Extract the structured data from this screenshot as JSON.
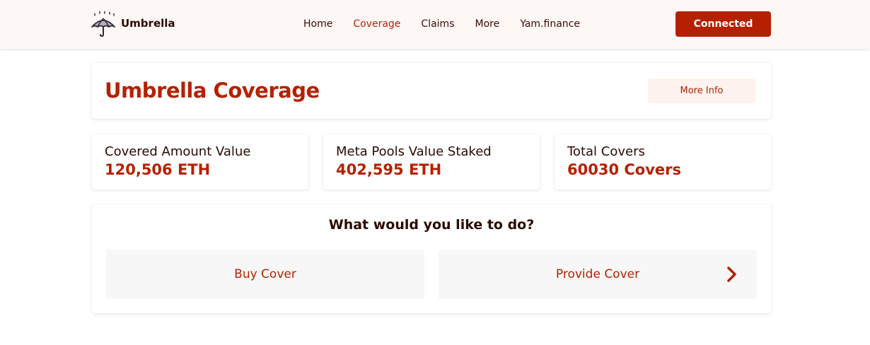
{
  "header": {
    "logo_text": "Umbrella",
    "logo_icon": "umbrella-rain-icon",
    "nav": [
      {
        "label": "Home",
        "active": false
      },
      {
        "label": "Coverage",
        "active": true
      },
      {
        "label": "Claims",
        "active": false
      },
      {
        "label": "More",
        "active": false
      },
      {
        "label": "Yam.finance",
        "active": false
      }
    ],
    "connect_label": "Connected"
  },
  "title_card": {
    "title": "Umbrella Coverage",
    "more_info_label": "More Info"
  },
  "stats": [
    {
      "label": "Covered Amount Value",
      "value": "120,506 ETH"
    },
    {
      "label": "Meta Pools Value Staked",
      "value": "402,595 ETH"
    },
    {
      "label": "Total Covers",
      "value": "60030 Covers"
    }
  ],
  "actions": {
    "question": "What would you like to do?",
    "buy_label": "Buy Cover",
    "provide_label": "Provide Cover",
    "provide_icon": "chevron-right-icon"
  },
  "colors": {
    "accent": "#b52100",
    "header_bg": "#fdf7f5",
    "text_dark": "#2b0a00",
    "button_light": "#fdf2ee",
    "action_bg": "#f7f7f7"
  }
}
